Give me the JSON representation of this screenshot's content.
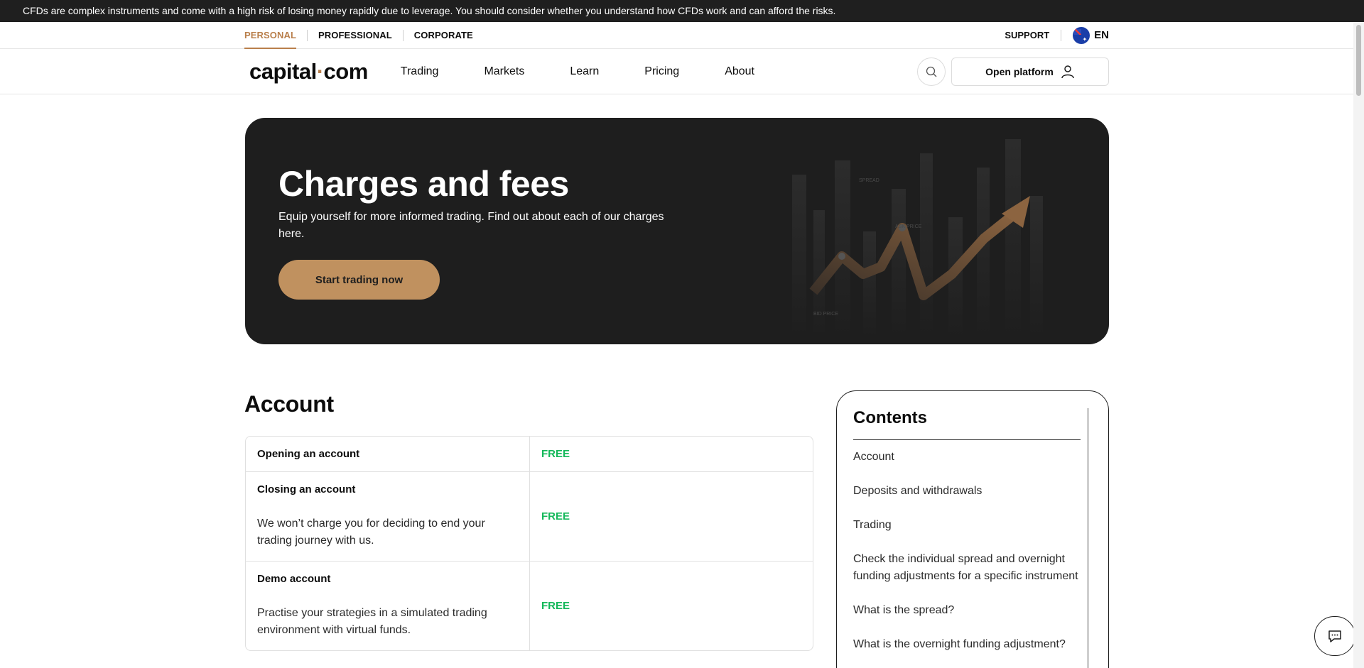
{
  "risk_warning": "CFDs are complex instruments and come with a high risk of losing money rapidly due to leverage. You should consider whether you understand how CFDs work and can afford the risks.",
  "segments": {
    "personal": "PERSONAL",
    "professional": "PROFESSIONAL",
    "corporate": "CORPORATE"
  },
  "support_label": "SUPPORT",
  "language": "EN",
  "logo": {
    "main": "capital",
    "dot": "·",
    "tld": "com"
  },
  "nav": {
    "trading": "Trading",
    "markets": "Markets",
    "learn": "Learn",
    "pricing": "Pricing",
    "about": "About"
  },
  "open_platform_label": "Open platform",
  "hero": {
    "title": "Charges and fees",
    "subtitle": "Equip yourself for more informed trading. Find out about each of our charges here.",
    "cta": "Start trading now",
    "art_labels": {
      "spread": "SPREAD",
      "ask": "ASK PRICE",
      "bid": "BID PRICE"
    }
  },
  "account": {
    "title": "Account",
    "rows": [
      {
        "name": "Opening an account",
        "desc": "",
        "value": "FREE"
      },
      {
        "name": "Closing an account",
        "desc": "We won’t charge you for deciding to end your trading journey with us.",
        "value": "FREE"
      },
      {
        "name": "Demo account",
        "desc": "Practise your strategies in a simulated trading environment with virtual funds.",
        "value": "FREE"
      }
    ]
  },
  "contents": {
    "title": "Contents",
    "items": [
      "Account",
      "Deposits and withdrawals",
      "Trading",
      "Check the individual spread and overnight funding adjustments for a specific instrument",
      "What is the spread?",
      "What is the overnight funding adjustment?"
    ]
  },
  "colors": {
    "accent": "#b97f4b",
    "cta": "#c0915f",
    "free": "#14b85a",
    "dark": "#1e1e1e"
  }
}
